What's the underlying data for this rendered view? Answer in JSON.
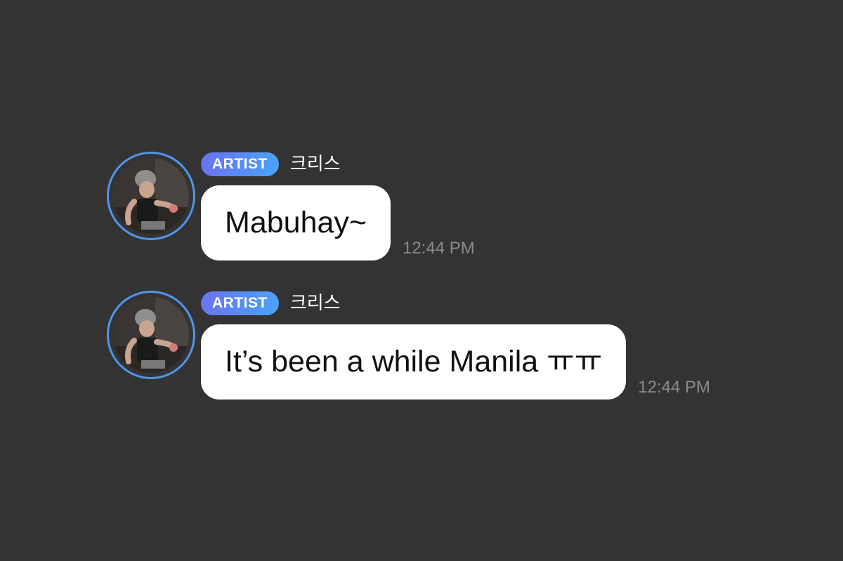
{
  "colors": {
    "background": "#333333",
    "bubble": "#ffffff",
    "avatar_ring": "#4f95ea",
    "badge_gradient_start": "#6a73f0",
    "badge_gradient_end": "#4aa3f7",
    "timestamp": "#8a8a8a"
  },
  "messages": [
    {
      "badge": "ARTIST",
      "sender": "크리스",
      "text": "Mabuhay~",
      "time": "12:44 PM",
      "avatar_icon": "profile-photo"
    },
    {
      "badge": "ARTIST",
      "sender": "크리스",
      "text": "It’s been a while Manila ㅠㅠ",
      "time": "12:44 PM",
      "avatar_icon": "profile-photo"
    }
  ]
}
